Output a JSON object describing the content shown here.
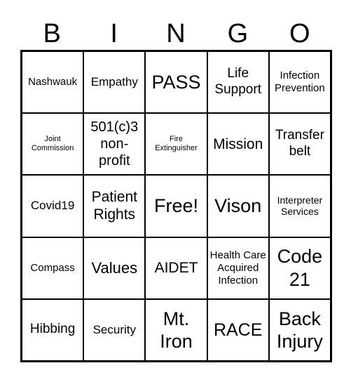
{
  "header": [
    "B",
    "I",
    "N",
    "G",
    "O"
  ],
  "cells": [
    "Nashwauk",
    "Empathy",
    "PASS",
    "Life Support",
    "Infection Prevention",
    "Joint Commission",
    "501(c)3 non-profit",
    "Fire Extinguisher",
    "Mission",
    "Transfer belt",
    "Covid19",
    "Patient Rights",
    "Free!",
    "Vison",
    "Interpreter Services",
    "Compass",
    "Values",
    "AIDET",
    "Health Care Acquired Infection",
    "Code 21",
    "Hibbing",
    "Security",
    "Mt. Iron",
    "RACE",
    "Back Injury"
  ]
}
